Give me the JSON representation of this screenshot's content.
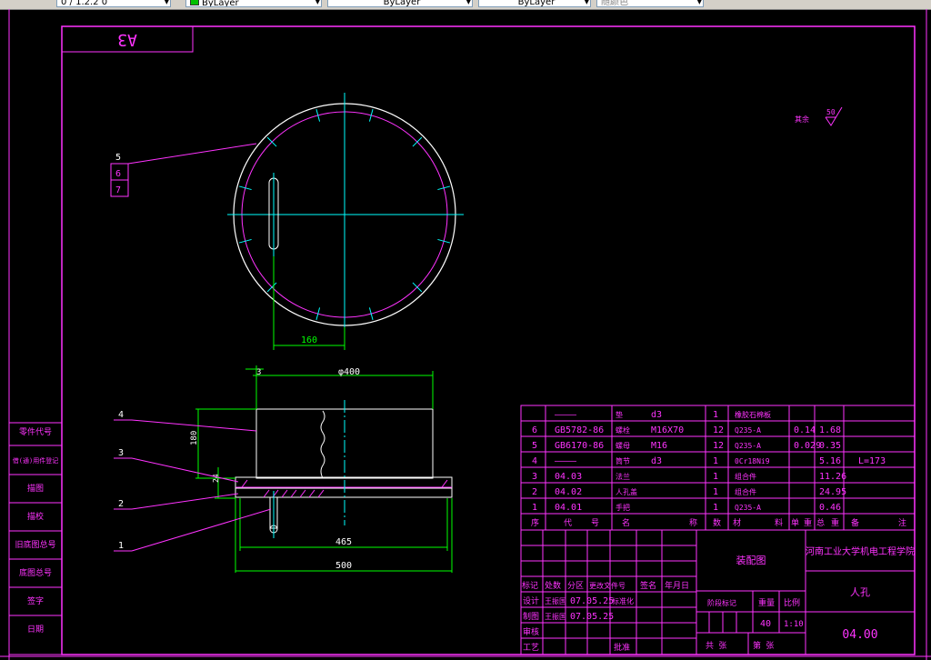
{
  "toolbar": {
    "layer_field": "0 / 1.2.2 0",
    "color": "ByLayer",
    "linetype": "ByLayer",
    "lineweight": "ByLayer",
    "plotstyle": "随颜色"
  },
  "drawing": {
    "sheet_size": "A3",
    "leaders_top": [
      "5",
      "6",
      "7"
    ],
    "leaders_side": [
      "4",
      "3",
      "2",
      "1"
    ],
    "dim_160": "160",
    "dim_phi400": "φ400",
    "dim_3": "3",
    "dim_180": "180",
    "dim_24": "24",
    "dim_465": "465",
    "dim_500": "500",
    "roughness_label": "其余",
    "roughness_value": "50",
    "length_note": "L=173"
  },
  "left_strip": [
    "零件代号",
    "借(通)用件登记",
    "描图",
    "描校",
    "旧底图总号",
    "底图总号",
    "签字",
    "日期"
  ],
  "bom": {
    "rows": [
      {
        "no": "",
        "code": "————",
        "name": "垫",
        "spec": "d3",
        "qty": "1",
        "material": "橡胶石棉板",
        "unit": "",
        "total": "",
        "note": ""
      },
      {
        "no": "6",
        "code": "GB5782-86",
        "name": "螺栓",
        "spec": "M16X70",
        "qty": "12",
        "material": "Q235-A",
        "unit": "0.14",
        "total": "1.68",
        "note": ""
      },
      {
        "no": "5",
        "code": "GB6170-86",
        "name": "螺母",
        "spec": "M16",
        "qty": "12",
        "material": "Q235-A",
        "unit": "0.029",
        "total": "0.35",
        "note": ""
      },
      {
        "no": "4",
        "code": "————",
        "name": "筒节",
        "spec": "d3",
        "qty": "1",
        "material": "0Cr18Ni9",
        "unit": "",
        "total": "5.16",
        "note": "L=173"
      },
      {
        "no": "3",
        "code": "04.03",
        "name": "法兰",
        "spec": "",
        "qty": "1",
        "material": "组合件",
        "unit": "",
        "total": "11.26",
        "note": ""
      },
      {
        "no": "2",
        "code": "04.02",
        "name": "人孔盖",
        "spec": "",
        "qty": "1",
        "material": "组合件",
        "unit": "",
        "total": "24.95",
        "note": ""
      },
      {
        "no": "1",
        "code": "04.01",
        "name": "手把",
        "spec": "",
        "qty": "1",
        "material": "Q235-A",
        "unit": "",
        "total": "0.46",
        "note": ""
      }
    ],
    "header": [
      "序",
      "代",
      "号",
      "名",
      "称",
      "数",
      "材",
      "料",
      "单",
      "重",
      "总",
      "重",
      "备",
      "注"
    ]
  },
  "title_block": {
    "drawing_type": "装配图",
    "school": "河南工业大学机电工程学院",
    "part_name": "人孔",
    "drawing_no": "04.00",
    "change_labels": [
      "标记",
      "处数",
      "分区",
      "更改文件号",
      "签名",
      "年月日"
    ],
    "design": {
      "label": "设计",
      "name": "王振国",
      "date": "07.05.25",
      "std": "标准化"
    },
    "draw": {
      "label": "制图",
      "name": "王振国",
      "date": "07.05.25"
    },
    "review": "审核",
    "process": "工艺",
    "approve": "批准",
    "stage_label": "阶段标记",
    "weight_label": "重量",
    "scale_label": "比例",
    "weight": "40",
    "scale": "1:10",
    "sheets": "共  张",
    "sheet": "第  张"
  },
  "colors": {
    "frame": "#ff33ff",
    "outline": "#ffffff",
    "center": "#00ffff",
    "dim": "#00ff00",
    "toolbar": "#d4d0c8"
  }
}
